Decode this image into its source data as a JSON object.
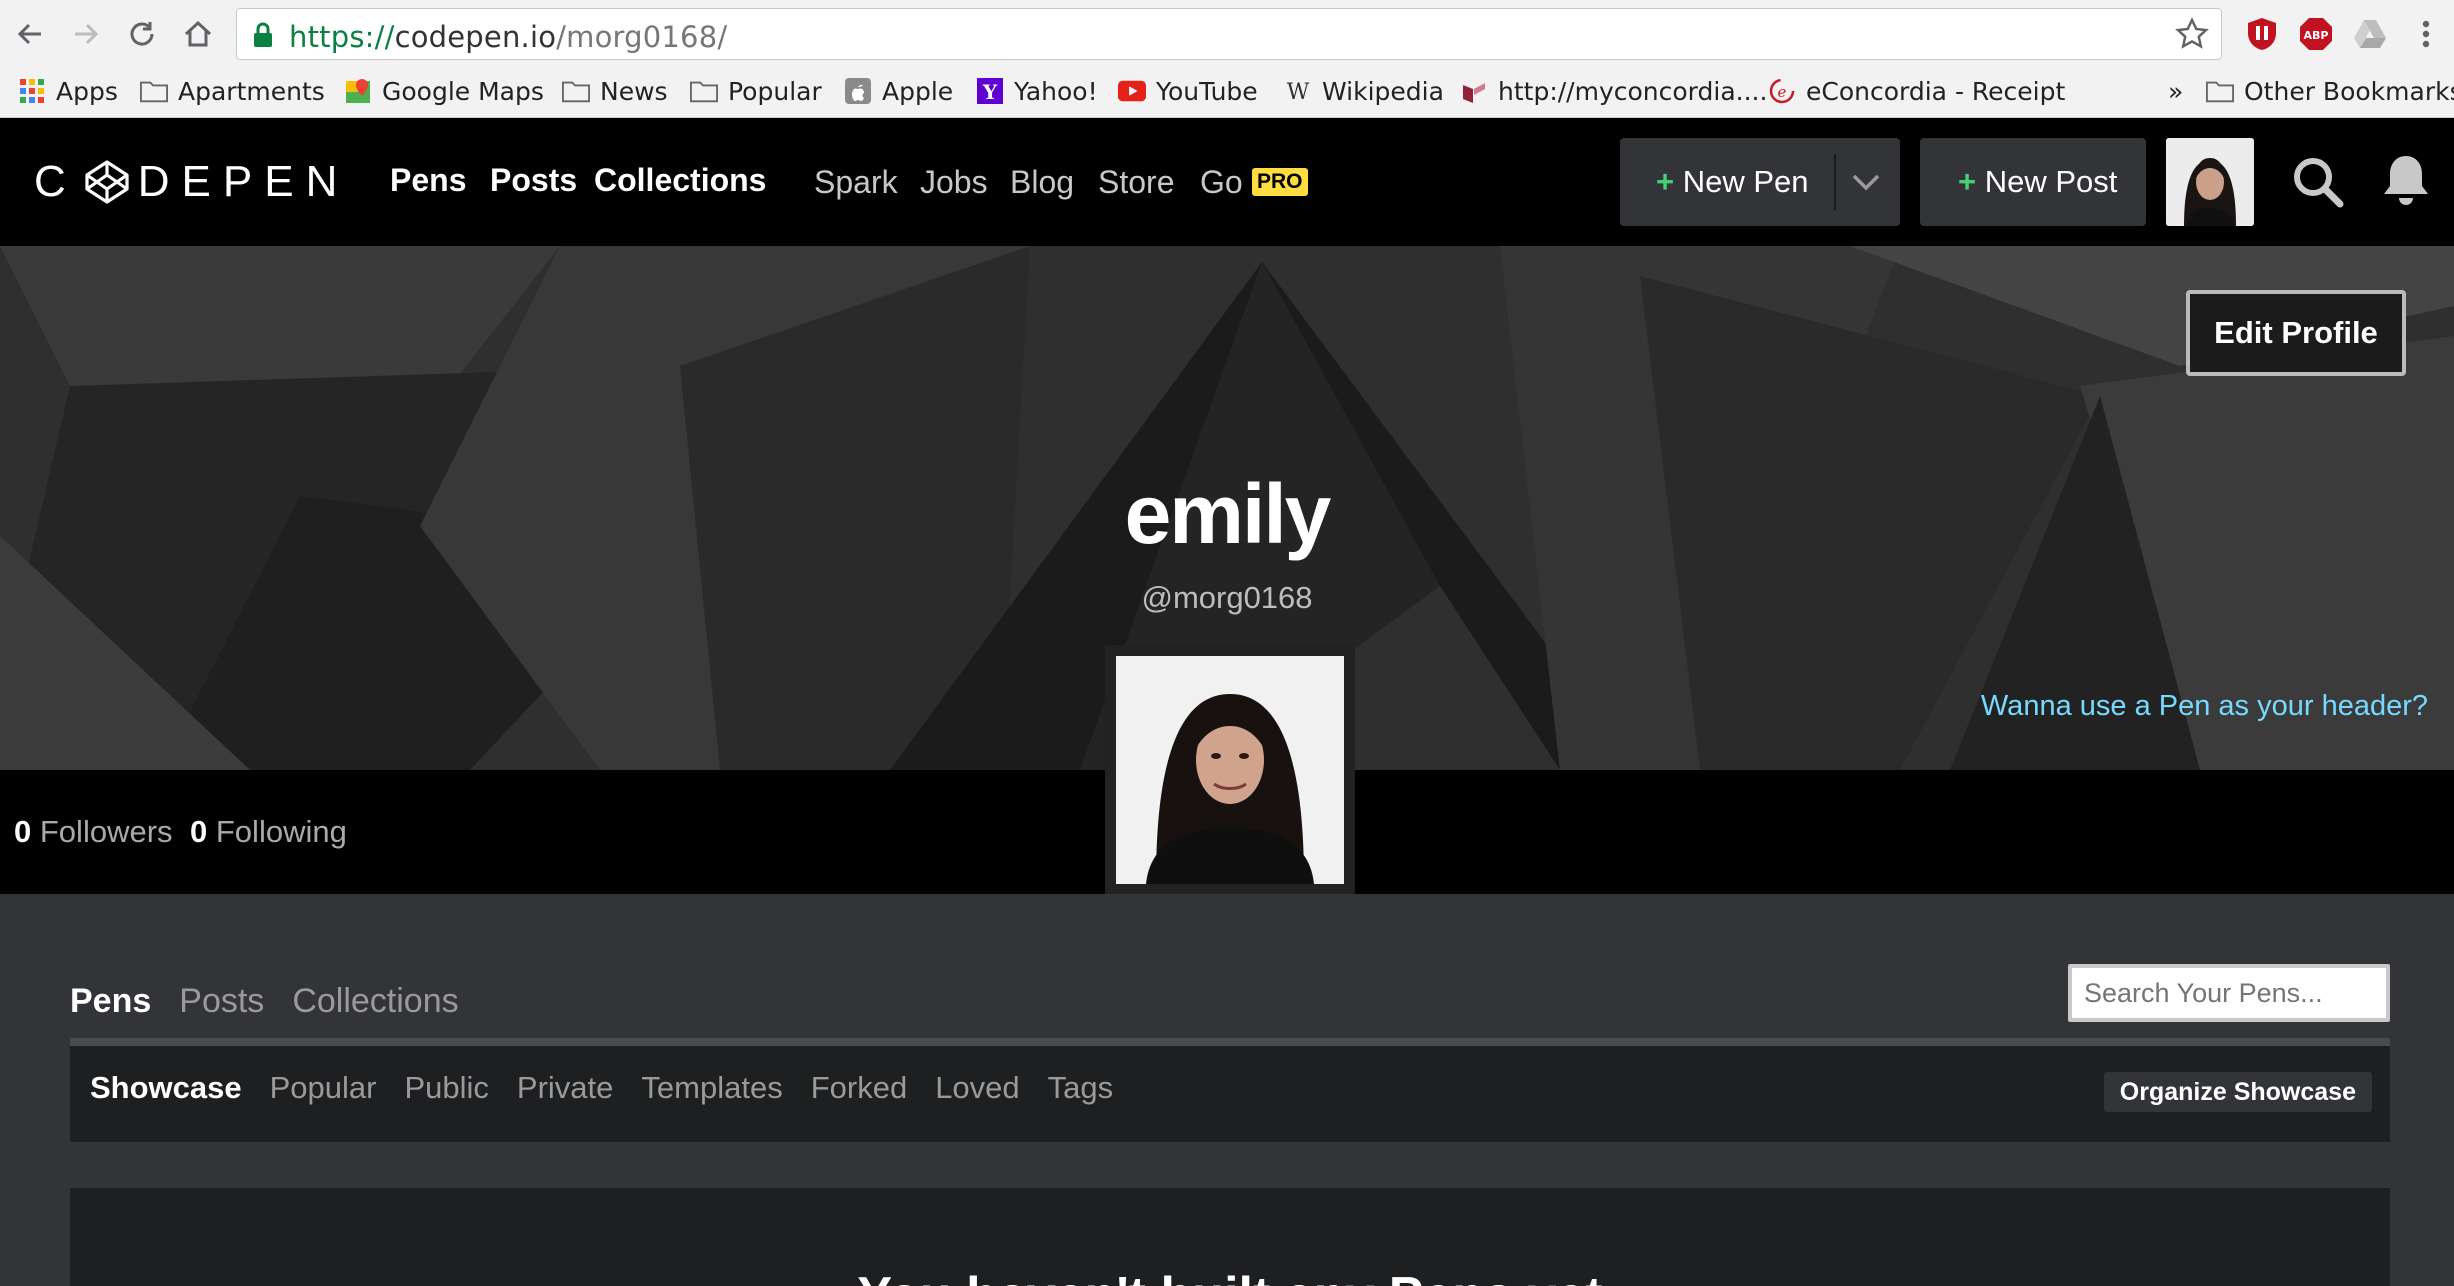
{
  "browser": {
    "url_scheme": "https://",
    "url_host": "codepen.io",
    "url_path": "/morg0168/",
    "bookmarks": [
      {
        "label": "Apps",
        "icon": "apps-grid-icon"
      },
      {
        "label": "Apartments",
        "icon": "folder-icon"
      },
      {
        "label": "Google Maps",
        "icon": "google-maps-icon"
      },
      {
        "label": "News",
        "icon": "folder-icon"
      },
      {
        "label": "Popular",
        "icon": "folder-icon"
      },
      {
        "label": "Apple",
        "icon": "apple-icon"
      },
      {
        "label": "Yahoo!",
        "icon": "yahoo-icon"
      },
      {
        "label": "YouTube",
        "icon": "youtube-icon"
      },
      {
        "label": "Wikipedia",
        "icon": "wikipedia-icon"
      },
      {
        "label": "http://myconcordia....",
        "icon": "concordia-icon"
      },
      {
        "label": "eConcordia - Receipt",
        "icon": "econcordia-icon"
      },
      {
        "label": "Other Bookmarks",
        "icon": "folder-icon"
      }
    ],
    "overflow_chevron": "»",
    "extensions": [
      "ublock-icon",
      "adblock-plus-icon",
      "drive-icon",
      "menu-kebab-icon"
    ],
    "abp_text": "ABP"
  },
  "header": {
    "logo_text": "DEPEN",
    "logo_prefix": "C",
    "main_nav": [
      "Pens",
      "Posts",
      "Collections"
    ],
    "sub_nav": [
      "Spark",
      "Jobs",
      "Blog",
      "Store",
      "Go"
    ],
    "pro_badge": "PRO",
    "new_pen_label": "New Pen",
    "new_post_label": "New Post",
    "plus_symbol": "+"
  },
  "profile": {
    "name": "emily",
    "handle": "@morg0168",
    "edit_button": "Edit Profile",
    "pen_header_link": "Wanna use a Pen as your header?",
    "followers_count": "0",
    "followers_label": "Followers",
    "following_count": "0",
    "following_label": "Following"
  },
  "content": {
    "tabs": [
      "Pens",
      "Posts",
      "Collections"
    ],
    "active_tab": "Pens",
    "search_placeholder": "Search Your Pens...",
    "subtabs": [
      "Showcase",
      "Popular",
      "Public",
      "Private",
      "Templates",
      "Forked",
      "Loved",
      "Tags"
    ],
    "active_subtab": "Showcase",
    "organize_button": "Organize Showcase",
    "empty_title": "You haven't built any Pens yet"
  },
  "colors": {
    "accent_green": "#47cf73",
    "pro_yellow": "#ffdd40",
    "link_blue": "#76daff"
  }
}
